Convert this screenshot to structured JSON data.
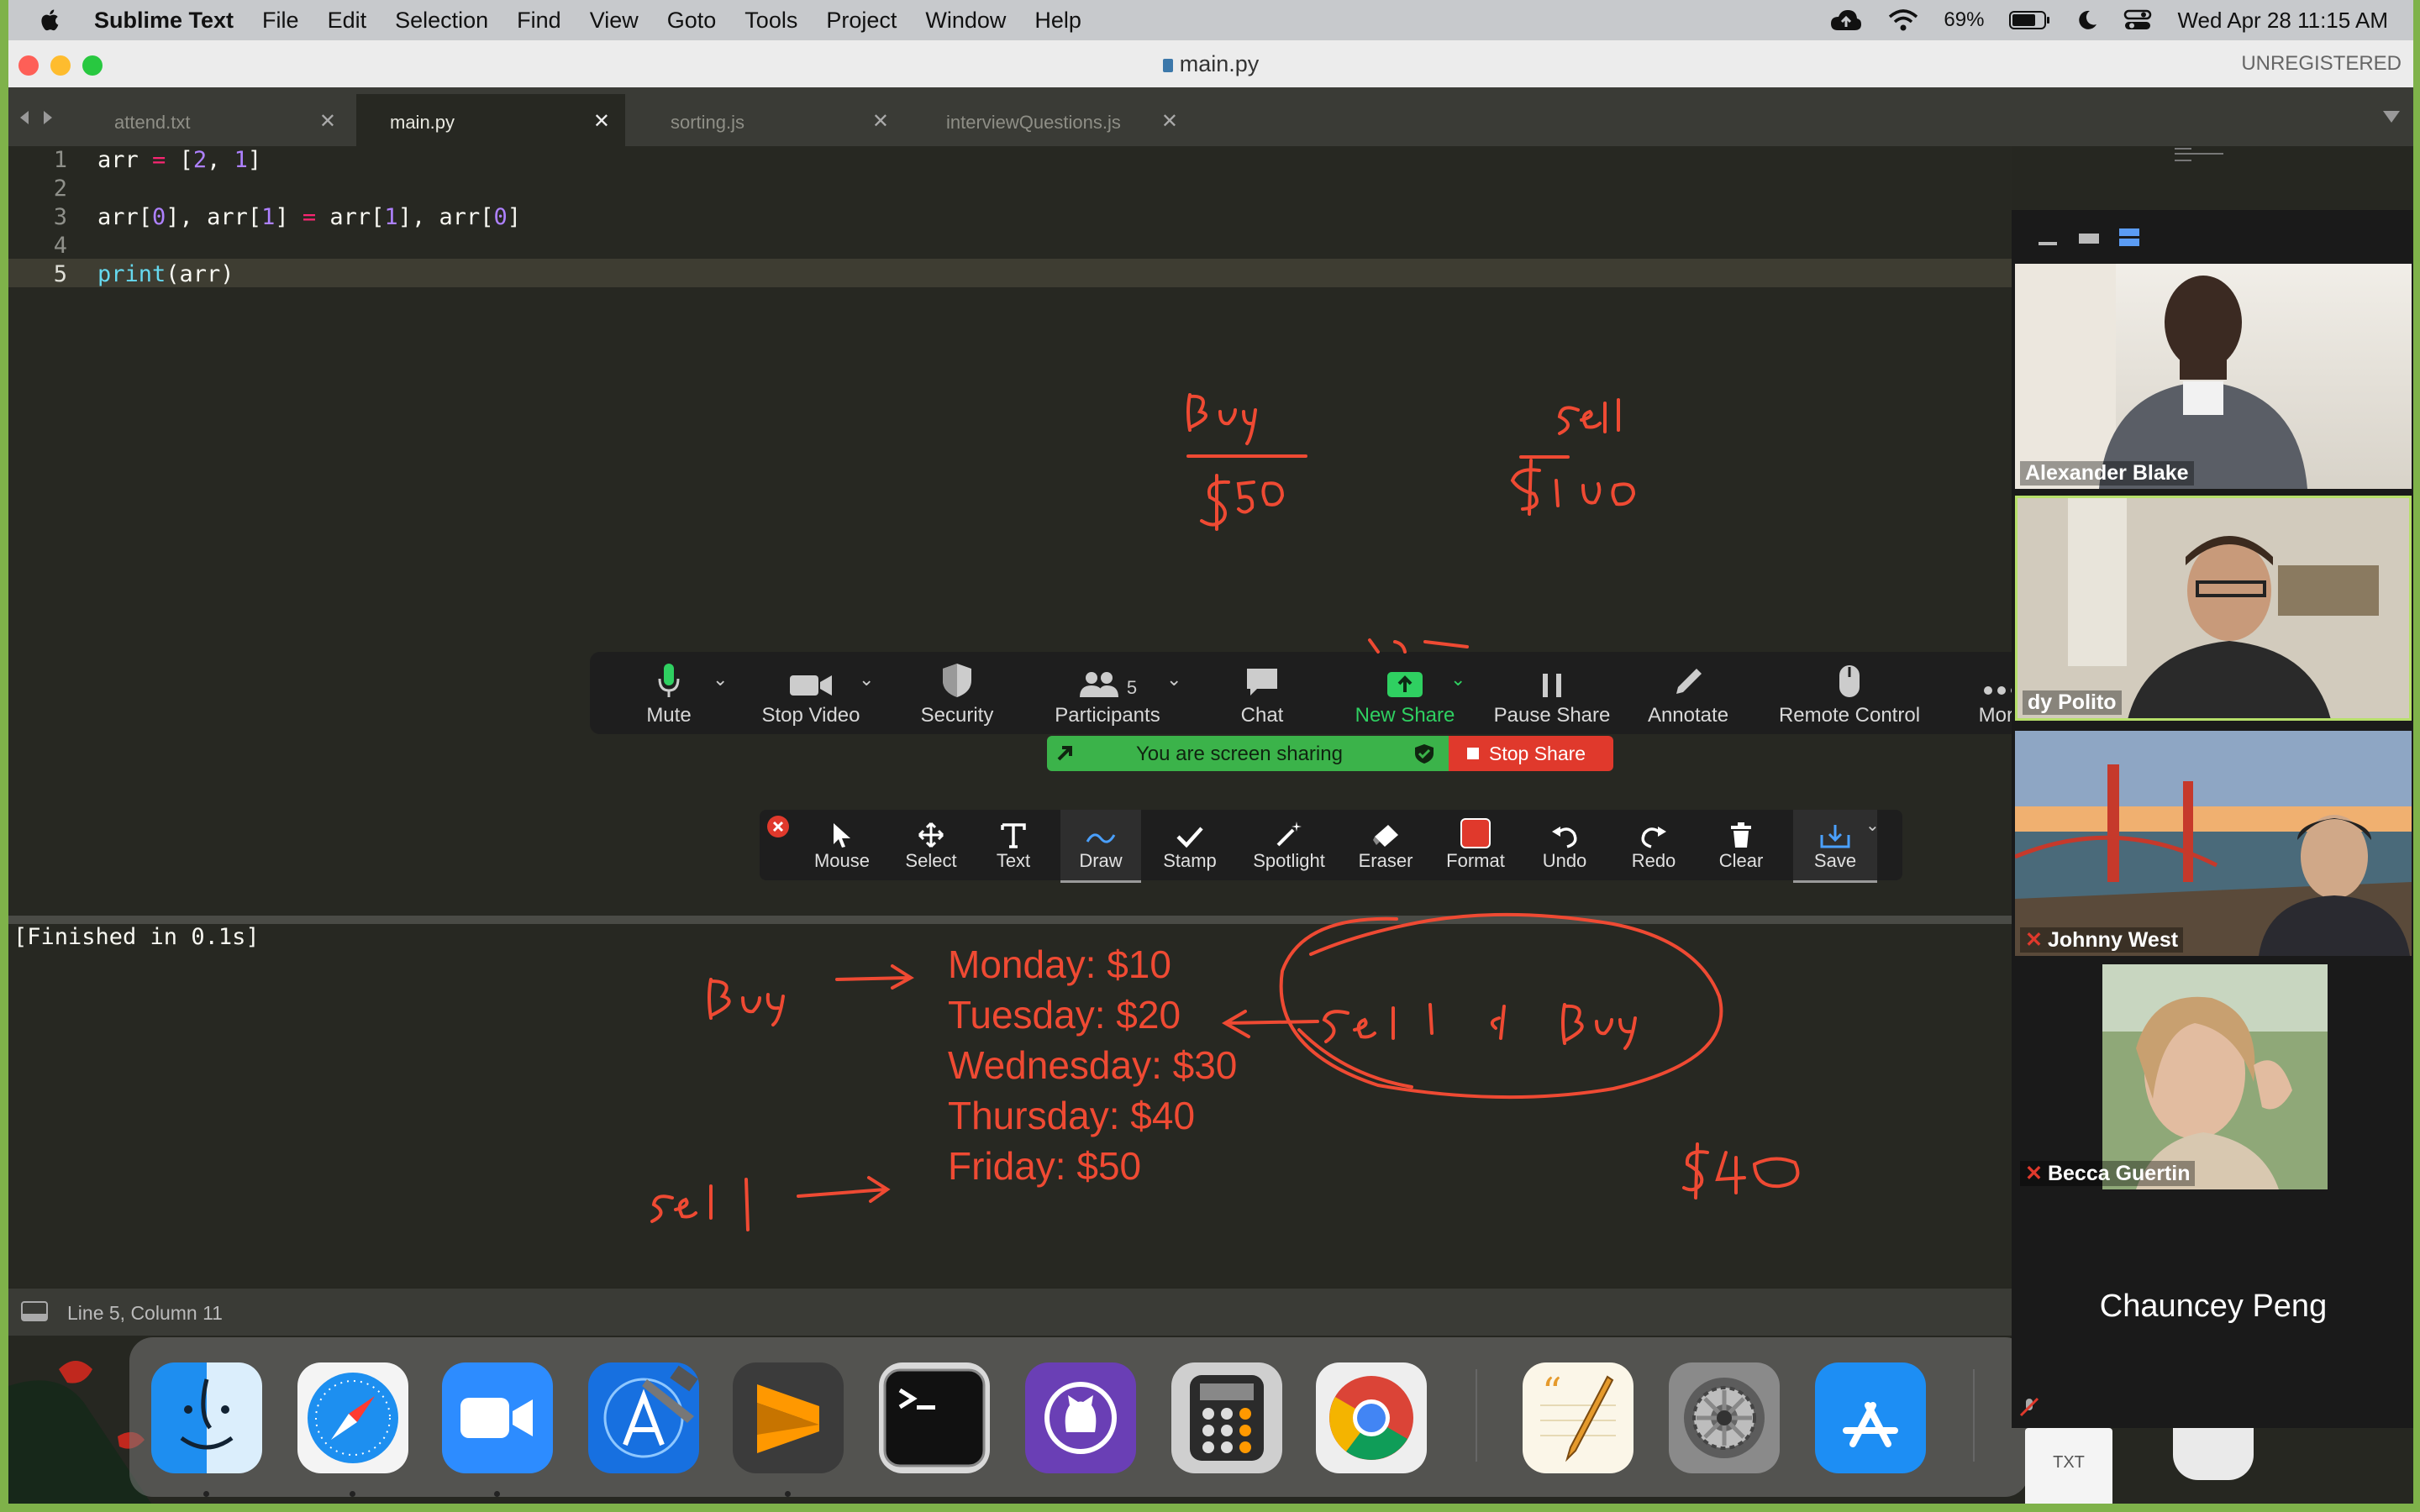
{
  "menubar": {
    "app": "Sublime Text",
    "items": [
      "File",
      "Edit",
      "Selection",
      "Find",
      "View",
      "Goto",
      "Tools",
      "Project",
      "Window",
      "Help"
    ],
    "battery": "69%",
    "clock": "Wed Apr 28  11:15 AM"
  },
  "window": {
    "title": "main.py",
    "status": "UNREGISTERED"
  },
  "tabs": [
    {
      "label": "attend.txt"
    },
    {
      "label": "main.py"
    },
    {
      "label": "sorting.js"
    },
    {
      "label": "interviewQuestions.js"
    }
  ],
  "editor": {
    "line_numbers": [
      "1",
      "2",
      "3",
      "4",
      "5"
    ]
  },
  "output": {
    "text": "[Finished in 0.1s]"
  },
  "statusbar": {
    "position": "Line 5, Column 11"
  },
  "zoom_toolbar": {
    "mute": "Mute",
    "stop_video": "Stop Video",
    "security": "Security",
    "participants": "Participants",
    "participant_count": "5",
    "chat": "Chat",
    "new_share": "New Share",
    "pause_share": "Pause Share",
    "annotate": "Annotate",
    "remote_control": "Remote Control",
    "more": "More"
  },
  "share_banner": {
    "text": "You are screen sharing",
    "stop": "Stop Share"
  },
  "annotate_toolbar": {
    "mouse": "Mouse",
    "select": "Select",
    "text": "Text",
    "draw": "Draw",
    "stamp": "Stamp",
    "spotlight": "Spotlight",
    "eraser": "Eraser",
    "format": "Format",
    "undo": "Undo",
    "redo": "Redo",
    "clear": "Clear",
    "save": "Save"
  },
  "typed_annotations": {
    "mon": "Monday: $10",
    "tue": "Tuesday: $20",
    "wed": "Wednesday: $30",
    "thu": "Thursday: $40",
    "fri": "Friday: $50"
  },
  "participants": {
    "p1": "Alexander Blake",
    "p2": "dy Polito",
    "p3": "Johnny West",
    "p4": "Becca Guertin",
    "p5": "Chauncey Peng"
  },
  "colors": {
    "accent_green": "#3bb34a",
    "annotation_red": "#ef4a33",
    "stop_red": "#e0392c"
  },
  "dock": {
    "icons": [
      "finder-icon",
      "safari-icon",
      "zoom-icon",
      "xcode-icon",
      "sublime-icon",
      "terminal-icon",
      "github-desktop-icon",
      "calculator-icon",
      "chrome-icon",
      "pages-icon",
      "system-preferences-icon",
      "app-store-icon"
    ],
    "doc_label": "TXT"
  }
}
